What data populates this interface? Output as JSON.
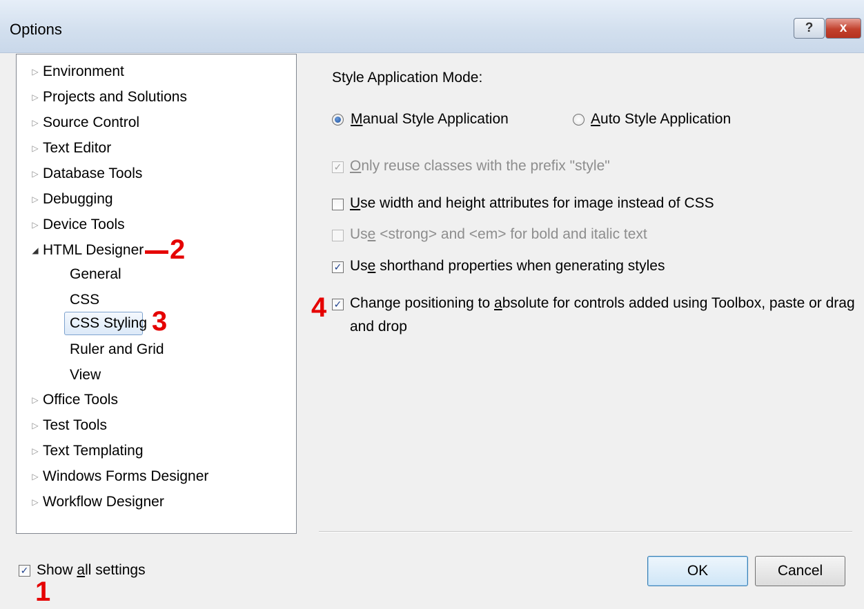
{
  "window": {
    "title": "Options",
    "help_glyph": "?",
    "close_glyph": "x"
  },
  "tree": {
    "items": [
      {
        "label": "Environment"
      },
      {
        "label": "Projects and Solutions"
      },
      {
        "label": "Source Control"
      },
      {
        "label": "Text Editor"
      },
      {
        "label": "Database Tools"
      },
      {
        "label": "Debugging"
      },
      {
        "label": "Device Tools"
      },
      {
        "label": "HTML Designer",
        "expanded": true
      },
      {
        "label": "Office Tools"
      },
      {
        "label": "Test Tools"
      },
      {
        "label": "Text Templating"
      },
      {
        "label": "Windows Forms Designer"
      },
      {
        "label": "Workflow Designer"
      }
    ],
    "html_designer_children": [
      {
        "label": "General"
      },
      {
        "label": "CSS"
      },
      {
        "label": "CSS Styling",
        "selected": true
      },
      {
        "label": "Ruler and Grid"
      },
      {
        "label": "View"
      }
    ]
  },
  "annotations": {
    "one": "1",
    "two": "2",
    "three": "3",
    "four": "4"
  },
  "settings": {
    "style_mode_heading": "Style Application Mode:",
    "manual_radio": {
      "mnemonic": "M",
      "rest": "anual Style Application",
      "selected": true
    },
    "auto_radio": {
      "mnemonic": "A",
      "rest": "uto Style Application",
      "selected": false
    },
    "prefix_checkbox": {
      "mnemonic": "O",
      "rest": "nly reuse classes with the prefix \"style\"",
      "checked": true,
      "enabled": false
    },
    "width_height_checkbox": {
      "mnemonic": "U",
      "rest": "se width and height attributes for image instead of CSS",
      "checked": false,
      "enabled": true
    },
    "strong_em_checkbox": {
      "pre": "Us",
      "mnemonic": "e",
      "rest": " <strong> and <em> for bold and italic text",
      "checked": false,
      "enabled": false
    },
    "shorthand_checkbox": {
      "pre": "Us",
      "mnemonic": "e",
      "rest": " shorthand properties when generating styles",
      "checked": true,
      "enabled": true
    },
    "absolute_checkbox": {
      "pre": "Change positioning to ",
      "mnemonic": "a",
      "rest": "bsolute for controls added using Toolbox, paste or drag",
      "line2": "and drop",
      "checked": true,
      "enabled": true
    }
  },
  "footer": {
    "show_all": {
      "pre": "Show ",
      "mnemonic": "a",
      "rest": "ll settings",
      "checked": true
    },
    "ok_label": "OK",
    "cancel_label": "Cancel"
  },
  "check_glyph": "✓"
}
